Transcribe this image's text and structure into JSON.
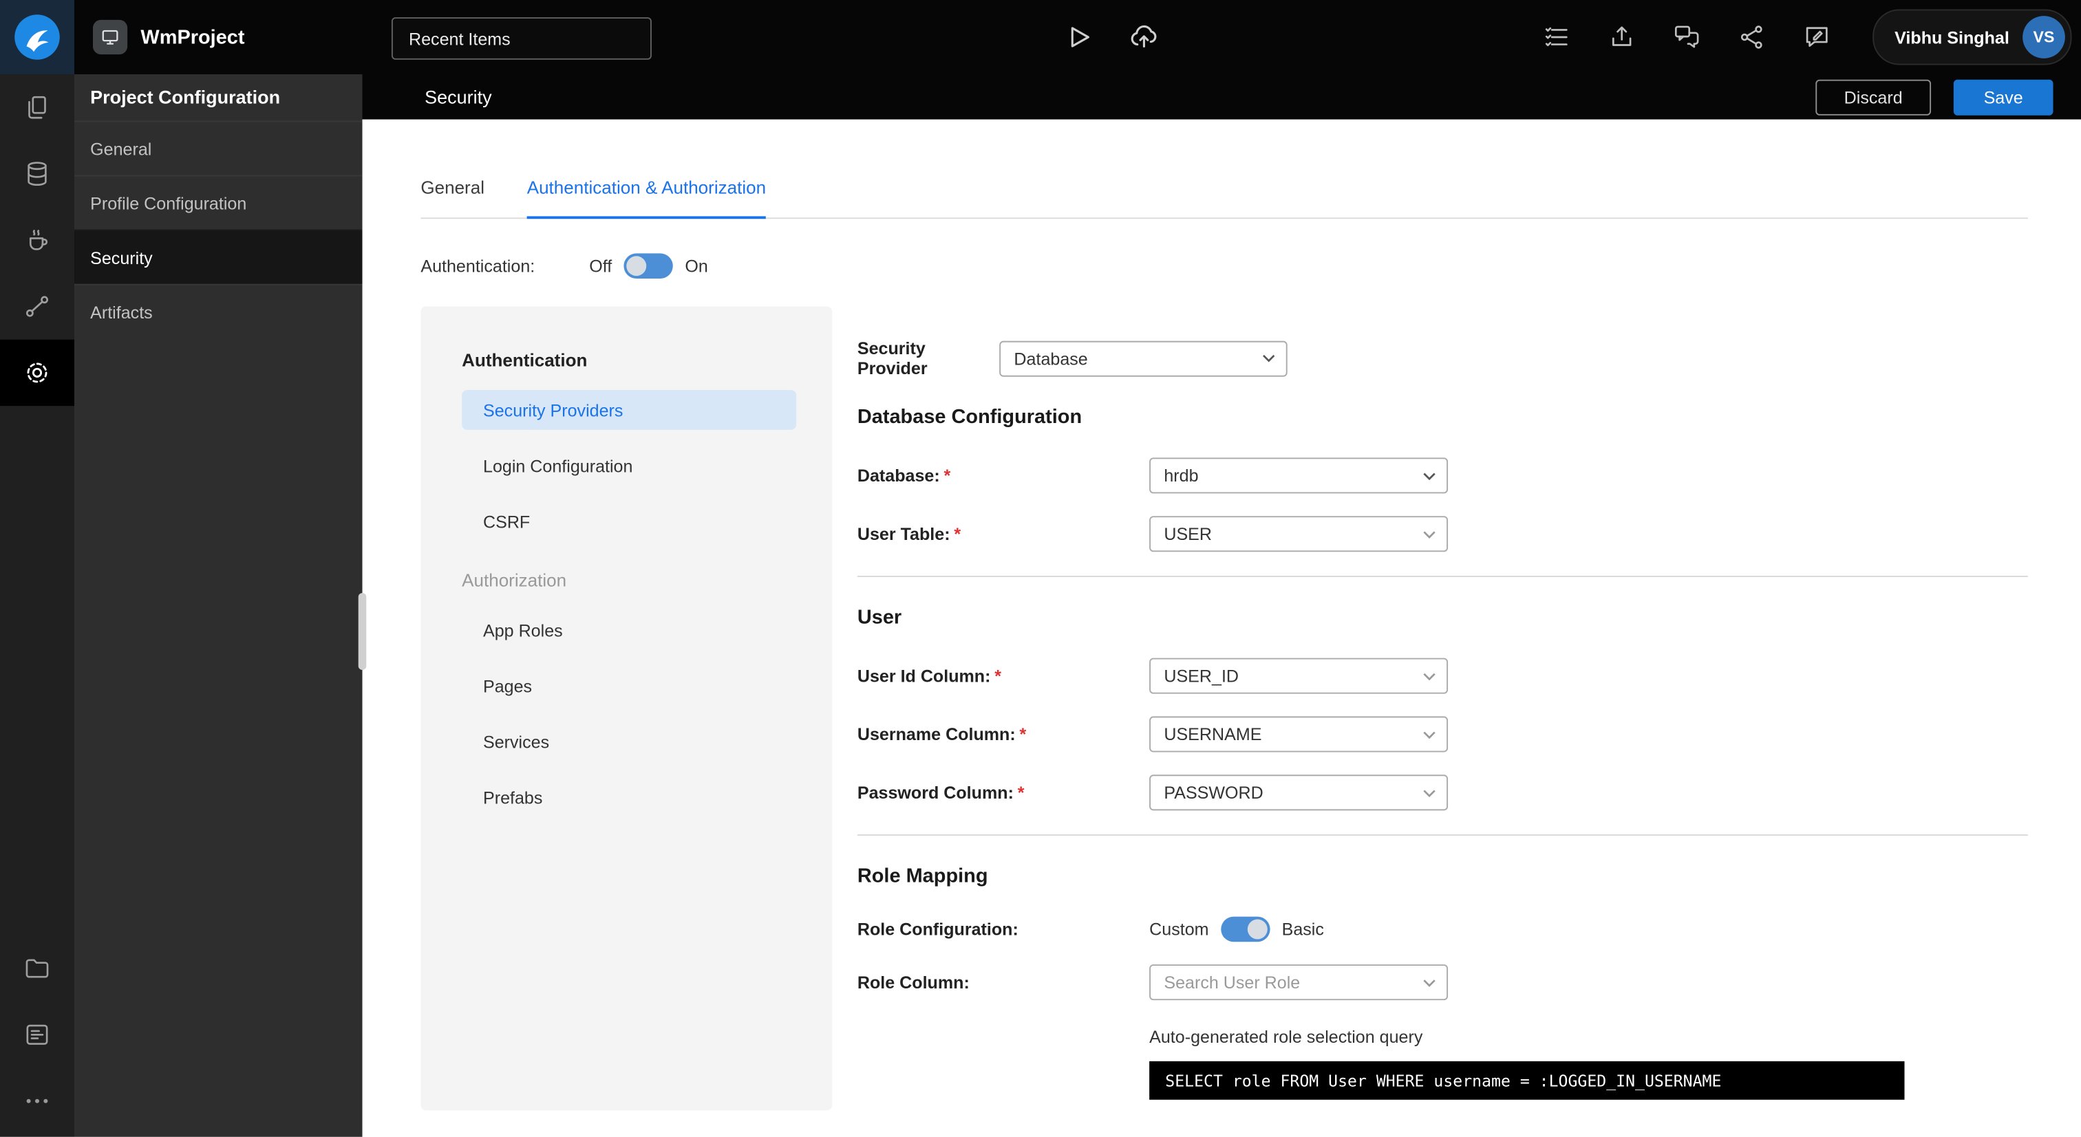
{
  "colors": {
    "accent_blue": "#1a73e8",
    "save_button": "#1976d2",
    "toggle_on": "#4d8fd6",
    "active_nav_item_bg": "#d8e7f7",
    "required_asterisk": "#e03131",
    "topbar_bg": "#060606",
    "rail_bg": "#202020",
    "sidebar_bg": "#2e2e2e",
    "panel_bg": "#f4f4f4",
    "code_block_bg": "#000000"
  },
  "ui": {
    "required_mark": "*"
  },
  "icons": {
    "topbar": [
      "wavemaker-logo",
      "project-app-icon",
      "play-icon",
      "cloud-upload-icon",
      "task-list-icon",
      "publish-icon",
      "chat-icon",
      "share-icon",
      "feedback-icon"
    ],
    "rail": [
      "pages-icon",
      "database-icon",
      "java-services-icon",
      "apis-icon",
      "settings-gear-icon",
      "folder-icon",
      "logs-icon",
      "more-icon"
    ],
    "form": [
      "chevron-down-icon"
    ]
  },
  "topbar": {
    "project_name": "WmProject",
    "recent_items_label": "Recent Items",
    "user": {
      "name": "Vibhu Singhal",
      "initials": "VS"
    }
  },
  "sidebar": {
    "title": "Project Configuration",
    "items": [
      {
        "label": "General",
        "active": false
      },
      {
        "label": "Profile Configuration",
        "active": false
      },
      {
        "label": "Security",
        "active": true
      },
      {
        "label": "Artifacts",
        "active": false
      }
    ]
  },
  "page_header": {
    "title": "Security",
    "discard_label": "Discard",
    "save_label": "Save"
  },
  "tabs": [
    {
      "label": "General",
      "active": false
    },
    {
      "label": "Authentication & Authorization",
      "active": true
    }
  ],
  "authentication": {
    "label": "Authentication:",
    "off_label": "Off",
    "on_label": "On",
    "state": "on"
  },
  "nav_panel": {
    "sections": [
      {
        "title": "Authentication",
        "items": [
          {
            "label": "Security Providers",
            "active": true
          },
          {
            "label": "Login Configuration",
            "active": false
          },
          {
            "label": "CSRF",
            "active": false
          }
        ]
      },
      {
        "title": "Authorization",
        "items": [
          {
            "label": "App Roles",
            "active": false
          },
          {
            "label": "Pages",
            "active": false
          },
          {
            "label": "Services",
            "active": false
          },
          {
            "label": "Prefabs",
            "active": false
          }
        ]
      }
    ]
  },
  "form": {
    "security_provider": {
      "label": "Security Provider",
      "value": "Database"
    },
    "database_config": {
      "title": "Database Configuration",
      "database": {
        "label": "Database:",
        "required": true,
        "value": "hrdb"
      },
      "user_table": {
        "label": "User Table:",
        "required": true,
        "value": "USER"
      }
    },
    "user_section": {
      "title": "User",
      "user_id_column": {
        "label": "User Id Column:",
        "required": true,
        "value": "USER_ID"
      },
      "username_column": {
        "label": "Username Column:",
        "required": true,
        "value": "USERNAME"
      },
      "password_column": {
        "label": "Password Column:",
        "required": true,
        "value": "PASSWORD"
      }
    },
    "role_mapping": {
      "title": "Role Mapping",
      "role_configuration": {
        "label": "Role Configuration:",
        "custom_label": "Custom",
        "basic_label": "Basic",
        "state": "basic"
      },
      "role_column": {
        "label": "Role Column:",
        "placeholder": "Search User Role",
        "value": ""
      },
      "query_caption": "Auto-generated role selection query",
      "query": "SELECT role FROM User WHERE username = :LOGGED_IN_USERNAME"
    }
  }
}
